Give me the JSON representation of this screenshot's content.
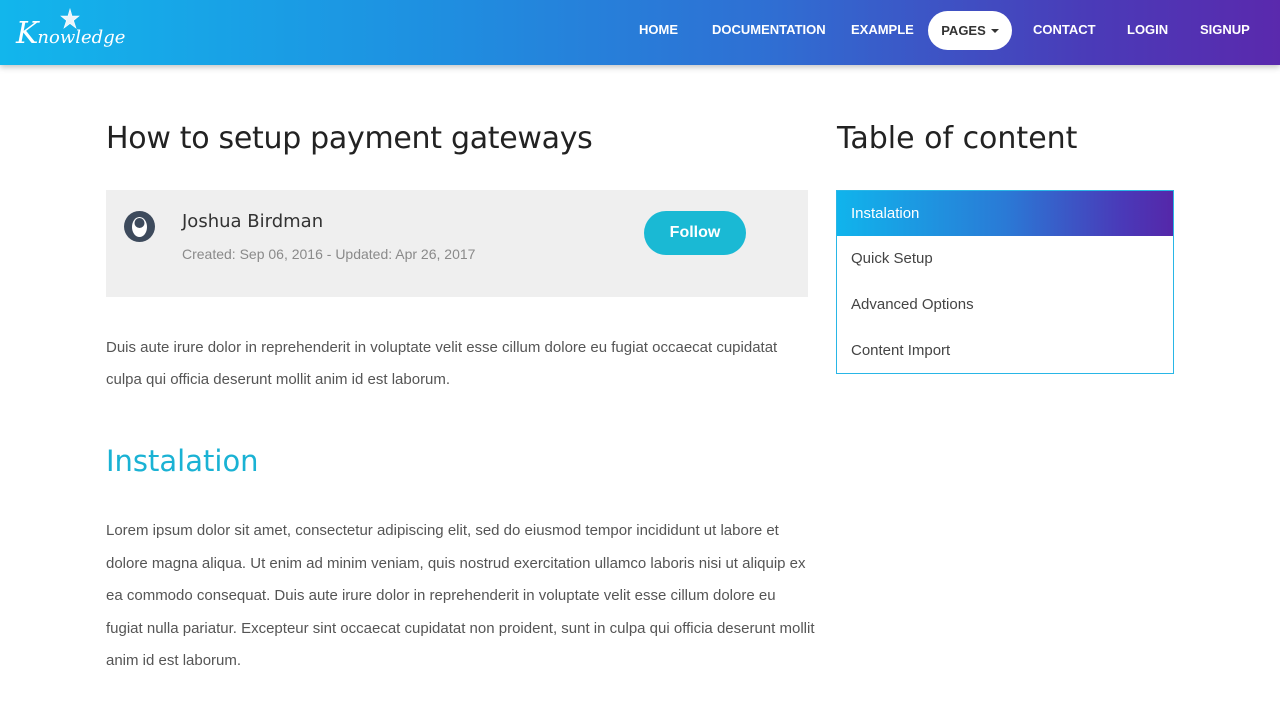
{
  "header": {
    "logo_letter": "K",
    "logo_rest": "nowledge",
    "nav": [
      {
        "label": "HOME"
      },
      {
        "label": "DOCUMENTATION"
      },
      {
        "label": "EXAMPLE"
      },
      {
        "label": "PAGES"
      },
      {
        "label": "CONTACT"
      },
      {
        "label": "LOGIN"
      },
      {
        "label": "SIGNUP"
      }
    ]
  },
  "article": {
    "title": "How to setup payment gateways",
    "author": {
      "name": "Joshua Birdman",
      "meta": "Created: Sep 06, 2016 - Updated: Apr 26, 2017",
      "follow_label": "Follow"
    },
    "intro": "Duis aute irure dolor in reprehenderit in voluptate velit esse cillum dolore eu fugiat occaecat cupidatat culpa qui officia deserunt mollit anim id est laborum.",
    "section_title": "Instalation",
    "section_body": "Lorem ipsum dolor sit amet, consectetur adipiscing elit, sed do eiusmod tempor incididunt ut labore et dolore magna aliqua. Ut enim ad minim veniam, quis nostrud exercitation ullamco laboris nisi ut aliquip ex ea commodo consequat. Duis aute irure dolor in reprehenderit in voluptate velit esse cillum dolore eu fugiat nulla pariatur. Excepteur sint occaecat cupidatat non proident, sunt in culpa qui officia deserunt mollit anim id est laborum."
  },
  "toc": {
    "title": "Table of content",
    "items": [
      {
        "label": "Instalation",
        "active": true
      },
      {
        "label": "Quick Setup",
        "active": false
      },
      {
        "label": "Advanced Options",
        "active": false
      },
      {
        "label": "Content Import",
        "active": false
      }
    ]
  },
  "colors": {
    "accent": "#1ab9d4",
    "gradient_start": "#12b6ec",
    "gradient_end": "#5a29ad",
    "card_bg": "#efefef"
  },
  "icons": {
    "avatar": "user-avatar-icon",
    "logo_mark": "bird-star-icon",
    "pages_caret": "caret-down-icon"
  }
}
